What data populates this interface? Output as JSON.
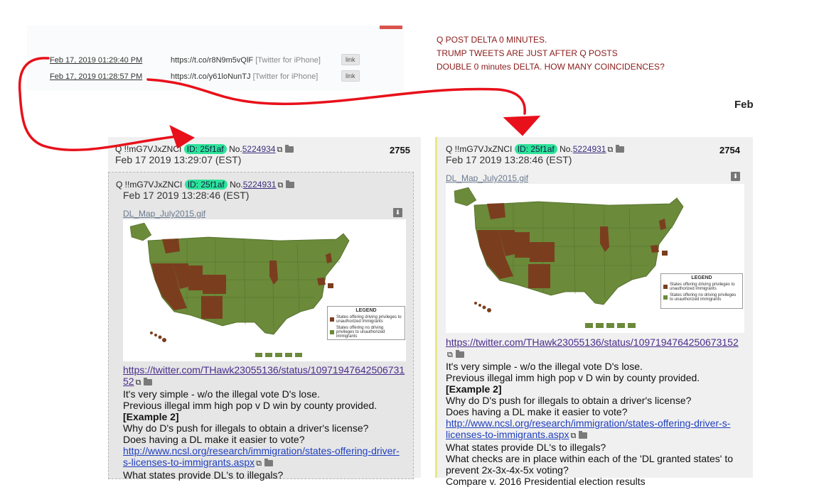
{
  "tweets": [
    {
      "date": "Feb 17, 2019 01:29:40 PM",
      "url": "https://t.co/r8N9m5vQlF",
      "source": "[Twitter for iPhone]",
      "link": "link"
    },
    {
      "date": "Feb 17, 2019 01:28:57 PM",
      "url": "https://t.co/y61loNunTJ",
      "source": "[Twitter for iPhone]",
      "link": "link"
    }
  ],
  "annotation": {
    "line1": "Q POST DELTA 0 MINUTES.",
    "line2": "TRUMP TWEETS ARE JUST AFTER Q POSTS",
    "line3": "DOUBLE 0 minutes DELTA. HOW MANY COINCIDENCES?"
  },
  "cut_text": "Feb",
  "colors": {
    "annotation": "#8b1a1a",
    "id_badge": "#2ee39a",
    "arrow": "#e8101a",
    "map_land": "#6b8a3a",
    "map_highlight": "#7a3e1e"
  },
  "posts": [
    {
      "author": "Q !!mG7VJxZNCI",
      "id": "ID: 25f1af",
      "no_label": "No.",
      "no": "5224934",
      "date": "Feb 17 2019 13:29:07 (EST)",
      "count": "2755",
      "quoted": {
        "author": "Q !!mG7VJxZNCI",
        "id": "ID: 25f1af",
        "no_label": "No.",
        "no": "5224931",
        "date": "Feb 17 2019 13:28:46 (EST)",
        "filename": "DL_Map_July2015.gif",
        "twitter_url_a": "https://twitter.com/THawk23055136/status/10971947642506731",
        "twitter_url_b": "52",
        "text1": "It's very simple - w/o the illegal vote D's lose.",
        "text2": "Previous illegal imm high pop v D win by county provided.",
        "example": "[Example 2]",
        "text3": "Why do D's push for illegals to obtain a driver's license?",
        "text4": "Does having a DL make it easier to vote?",
        "ncsl_a": "http://www.ncsl.org/research/immigration/states-offering-driver-",
        "ncsl_b": "s-licenses-to-immigrants.aspx",
        "text5": "What states provide DL's to illegals?"
      }
    },
    {
      "author": "Q !!mG7VJxZNCI",
      "id": "ID: 25f1af",
      "no_label": "No.",
      "no": "5224931",
      "date": "Feb 17 2019 13:28:46 (EST)",
      "count": "2754",
      "filename": "DL_Map_July2015.gif",
      "twitter_url": "https://twitter.com/THawk23055136/status/1097194764250673152",
      "text1": "It's very simple - w/o the illegal vote D's lose.",
      "text2": "Previous illegal imm high pop v D win by county provided.",
      "example": "[Example 2]",
      "text3": "Why do D's push for illegals to obtain a driver's license?",
      "text4": "Does having a DL make it easier to vote?",
      "ncsl_a": "http://www.ncsl.org/research/immigration/states-offering-driver-s-",
      "ncsl_b": "licenses-to-immigrants.aspx",
      "text5": "What states provide DL's to illegals?",
      "text6": "What checks are in place within each of the 'DL granted states' to",
      "text7": "prevent 2x-3x-4x-5x voting?",
      "text8": "Compare v. 2016 Presidential election results"
    }
  ],
  "map_legend": {
    "title": "LEGEND",
    "item1": "States offering driving privileges to unauthorized immigrants",
    "item2": "States offering no driving privileges to unauthorized immigrants"
  }
}
